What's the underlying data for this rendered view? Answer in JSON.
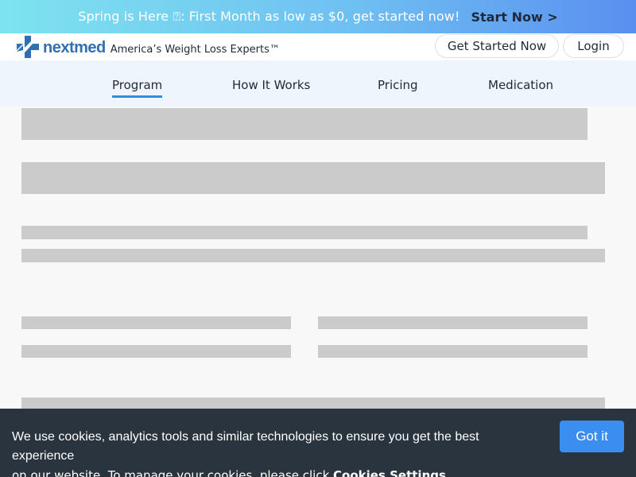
{
  "promo": {
    "text": "Spring is Here ⍰: First Month as low as $0, get started now!",
    "cta": "Start Now >"
  },
  "header": {
    "logo_text": "nextmed",
    "tagline": "America’s Weight Loss Experts™",
    "get_started_label": "Get Started Now",
    "login_label": "Login"
  },
  "nav": {
    "items": [
      {
        "label": "Program",
        "active": true
      },
      {
        "label": "How It Works",
        "active": false
      },
      {
        "label": "Pricing",
        "active": false
      },
      {
        "label": "Medication",
        "active": false
      }
    ]
  },
  "cookie": {
    "line1": "We use cookies, analytics tools and similar technologies to ensure you get the best experience",
    "line2_prefix": "on our website. To manage your cookies, please click ",
    "settings_link": "Cookies Settings",
    "button_label": "Got it"
  },
  "colors": {
    "accent": "#2f8ee0",
    "brand": "#2f6fb3",
    "cookie_bg": "#2a343e",
    "cookie_button": "#3a8ef0",
    "skeleton": "#cbcbcb"
  }
}
